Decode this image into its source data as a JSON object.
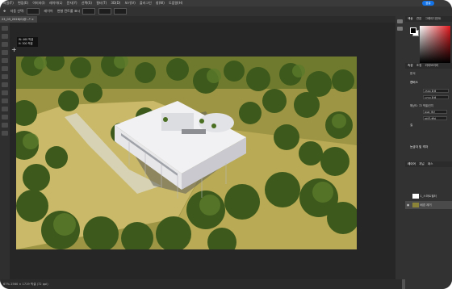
{
  "menu": {
    "items": [
      "파일(F)",
      "편집(E)",
      "이미지(I)",
      "레이어(L)",
      "문자(Y)",
      "선택(S)",
      "필터(T)",
      "3D(D)",
      "보기(V)",
      "플러그인",
      "창(W)",
      "도움말(H)"
    ],
    "share_label": "공유"
  },
  "options_bar": {
    "items": [
      "자동 선택:",
      "레이어",
      "변형 컨트롤 표시"
    ]
  },
  "document": {
    "tab_label": "23_03_2026(0)@...* ×",
    "tooltip": "W: 460 픽셀\nH: 300 픽셀",
    "status": "67% 2560 × 1719 픽셀 (72 ppi)"
  },
  "panels": {
    "color_tabs": [
      "색상",
      "견본",
      "그레이디언트"
    ],
    "props_tabs": [
      "속성",
      "조정",
      "라이브러리"
    ],
    "doc_label": "문서",
    "canvas_heading": "캔버스",
    "width_value": "2560 픽셀",
    "height_value": "1719 픽셀",
    "res_label": "해상도: 72 픽셀/인치",
    "mode_value": "RGB 색상",
    "depth_value": "8비트/채널",
    "fill_label": "칠",
    "rulers_heading": "눈금자 및 격자",
    "layers_tabs": [
      "레이어",
      "채널",
      "패스"
    ],
    "layers": [
      {
        "name": "1_스마트필터"
      },
      {
        "name": "배경",
        "note": "제거"
      }
    ]
  },
  "colors": {
    "accent": "#1473e6",
    "canvas_bg": "#262626",
    "panel_bg": "#323232"
  }
}
